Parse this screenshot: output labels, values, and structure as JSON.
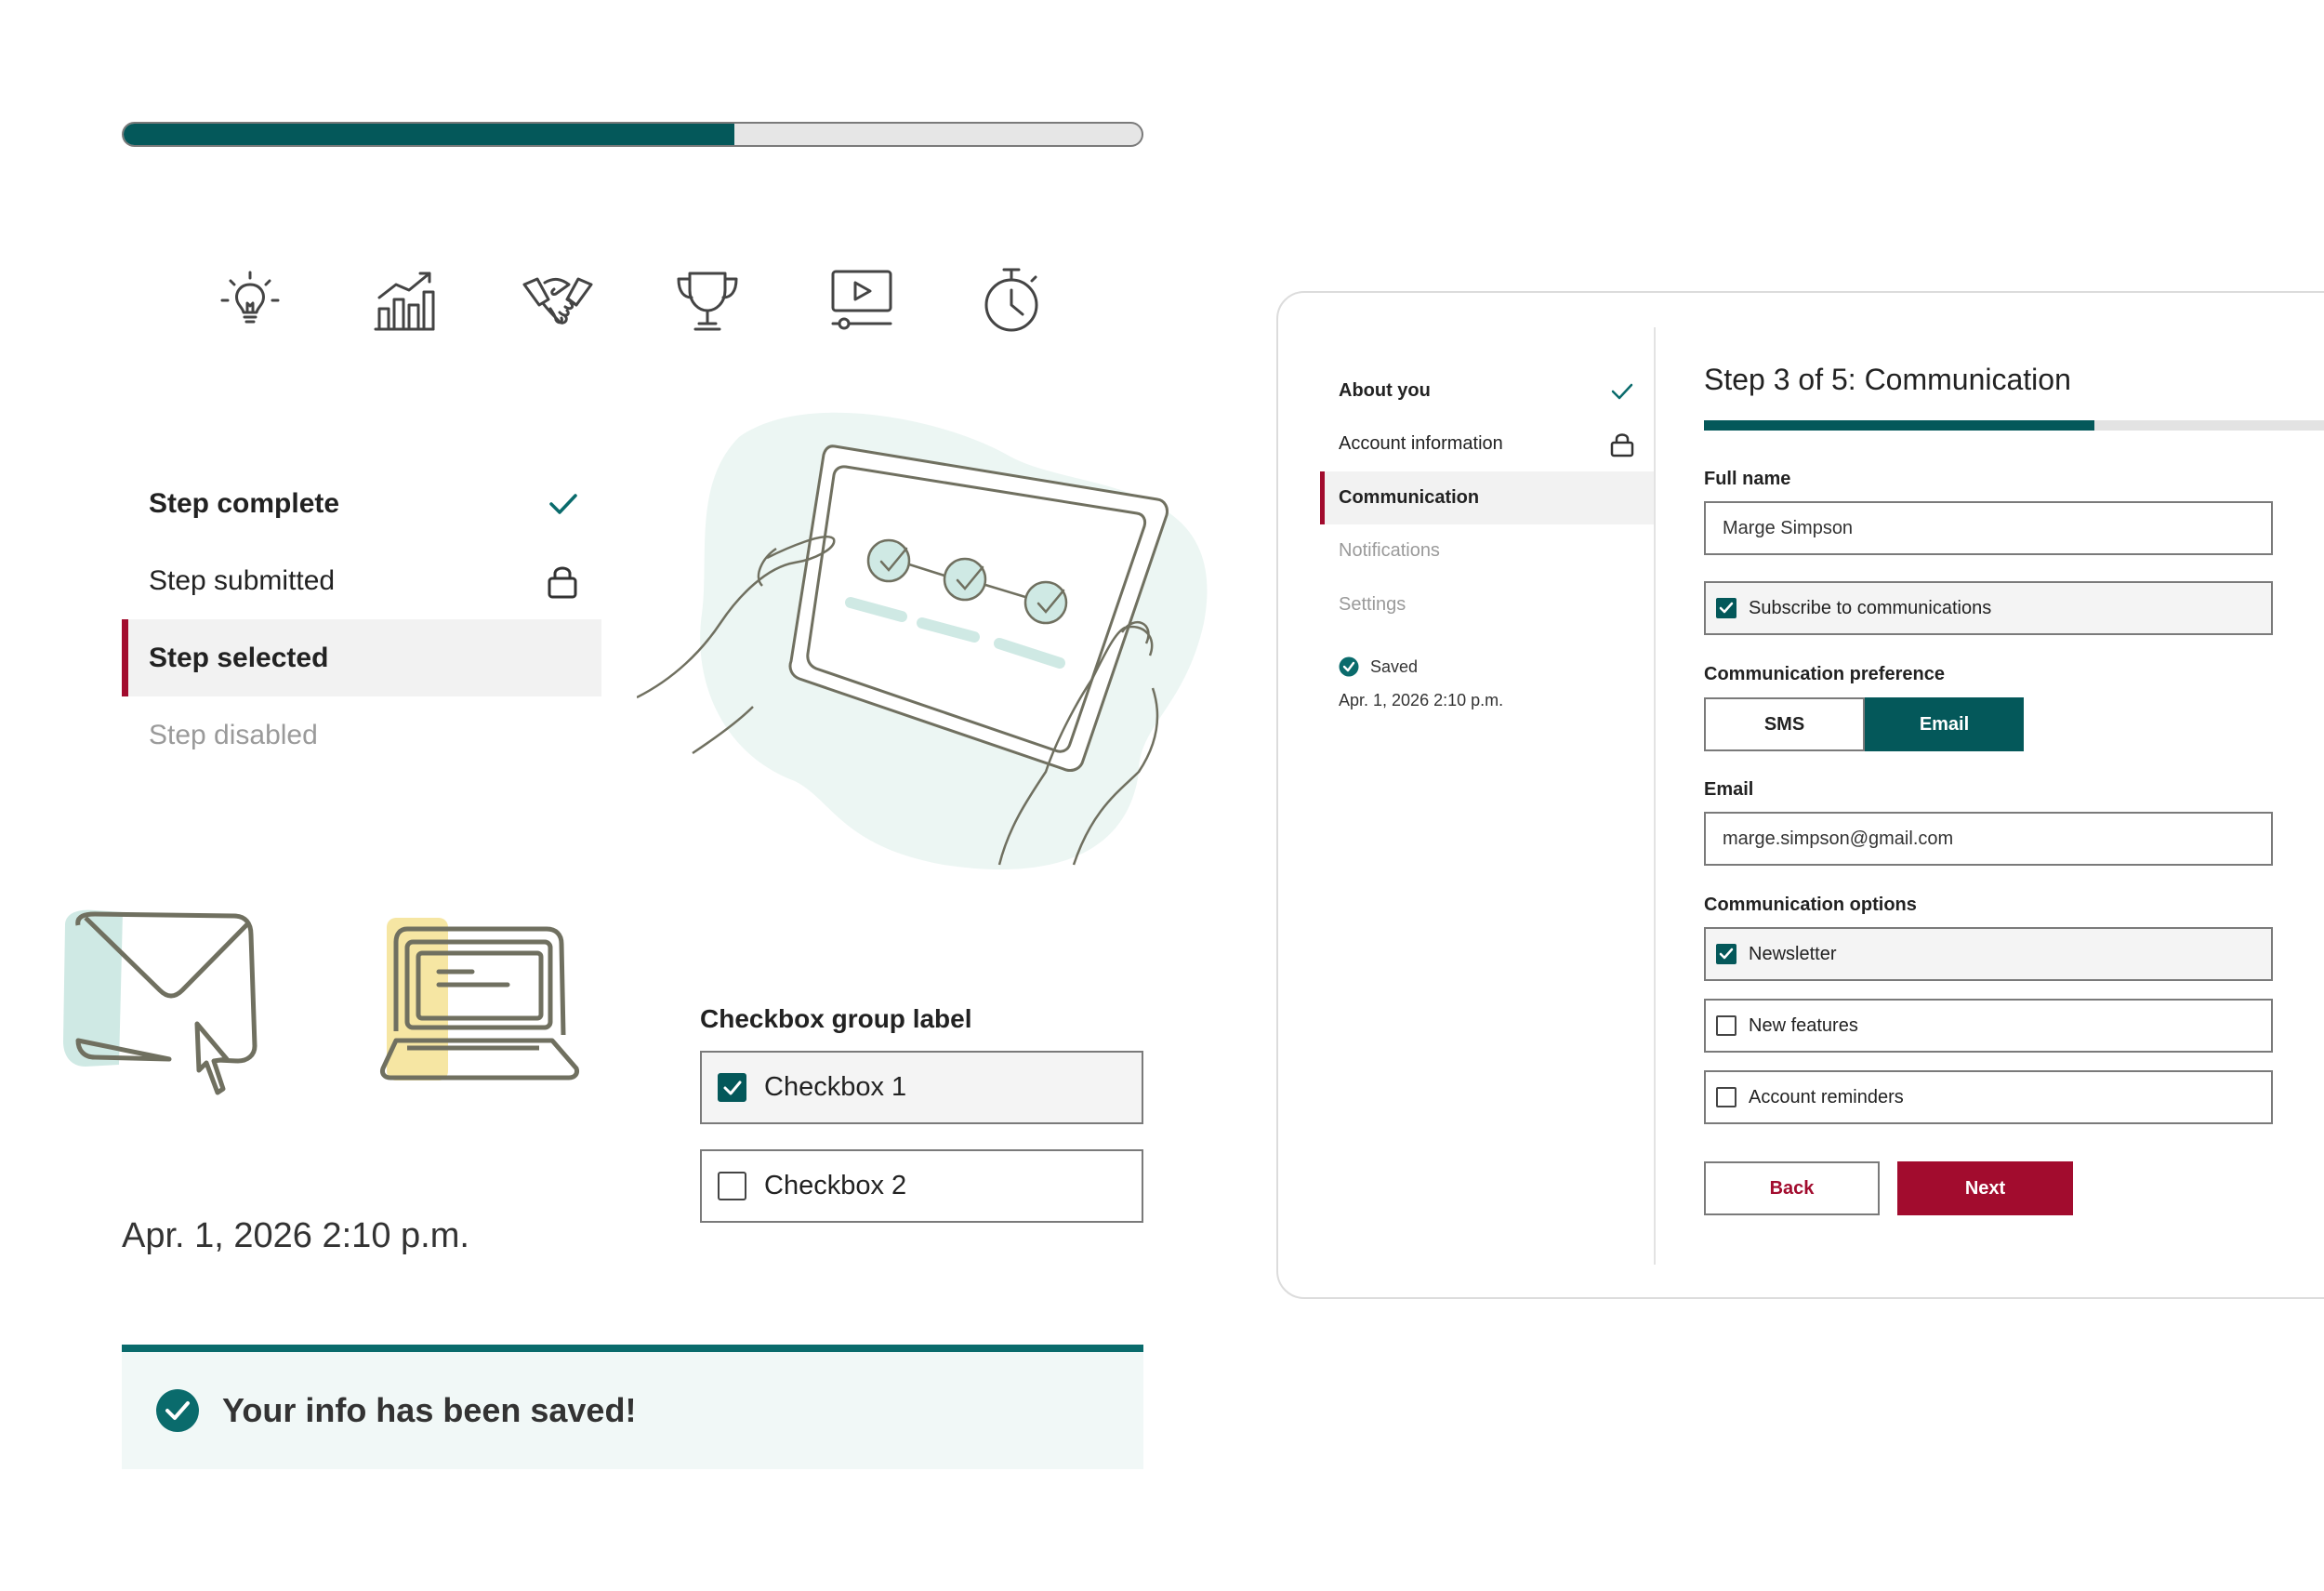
{
  "progress": {
    "value": 0.6
  },
  "icons": [
    "lightbulb-icon",
    "bar-chart-growth-icon",
    "handshake-icon",
    "trophy-icon",
    "video-play-icon",
    "stopwatch-icon"
  ],
  "steps": [
    {
      "label": "Step complete",
      "state": "complete",
      "icon": "check-icon"
    },
    {
      "label": "Step submitted",
      "state": "submitted",
      "icon": "lock-icon"
    },
    {
      "label": "Step selected",
      "state": "selected"
    },
    {
      "label": "Step disabled",
      "state": "disabled"
    }
  ],
  "checkbox_group": {
    "label": "Checkbox group label",
    "items": [
      {
        "label": "Checkbox 1",
        "checked": true
      },
      {
        "label": "Checkbox 2",
        "checked": false
      }
    ]
  },
  "date_left": "Apr. 1, 2026 2:10 p.m.",
  "banner": {
    "text": "Your info has been saved!"
  },
  "sidebar": {
    "items": [
      {
        "label": "About you",
        "state": "complete",
        "icon": "check-icon"
      },
      {
        "label": "Account information",
        "state": "submitted",
        "icon": "lock-icon"
      },
      {
        "label": "Communication",
        "state": "active"
      },
      {
        "label": "Notifications",
        "state": "disabled"
      },
      {
        "label": "Settings",
        "state": "disabled"
      }
    ],
    "saved_label": "Saved",
    "saved_date": "Apr. 1, 2026 2:10 p.m."
  },
  "form": {
    "title": "Step 3 of 5: Communication",
    "progress": 0.6,
    "full_name_label": "Full name",
    "full_name_value": "Marge Simpson",
    "subscribe_label": "Subscribe to communications",
    "subscribe_checked": true,
    "pref_label": "Communication preference",
    "pref_options": [
      "SMS",
      "Email"
    ],
    "pref_selected": "Email",
    "email_label": "Email",
    "email_value": "marge.simpson@gmail.com",
    "options_label": "Communication options",
    "options": [
      {
        "label": "Newsletter",
        "checked": true
      },
      {
        "label": "New features",
        "checked": false
      },
      {
        "label": "Account reminders",
        "checked": false
      }
    ],
    "back_label": "Back",
    "next_label": "Next"
  },
  "colors": {
    "primary_teal": "#04585a",
    "accent_red": "#a20c2e",
    "success_teal": "#0a6b6c",
    "illustration_mint": "#cfe9e4",
    "illustration_yellow": "#f6e6a3"
  }
}
